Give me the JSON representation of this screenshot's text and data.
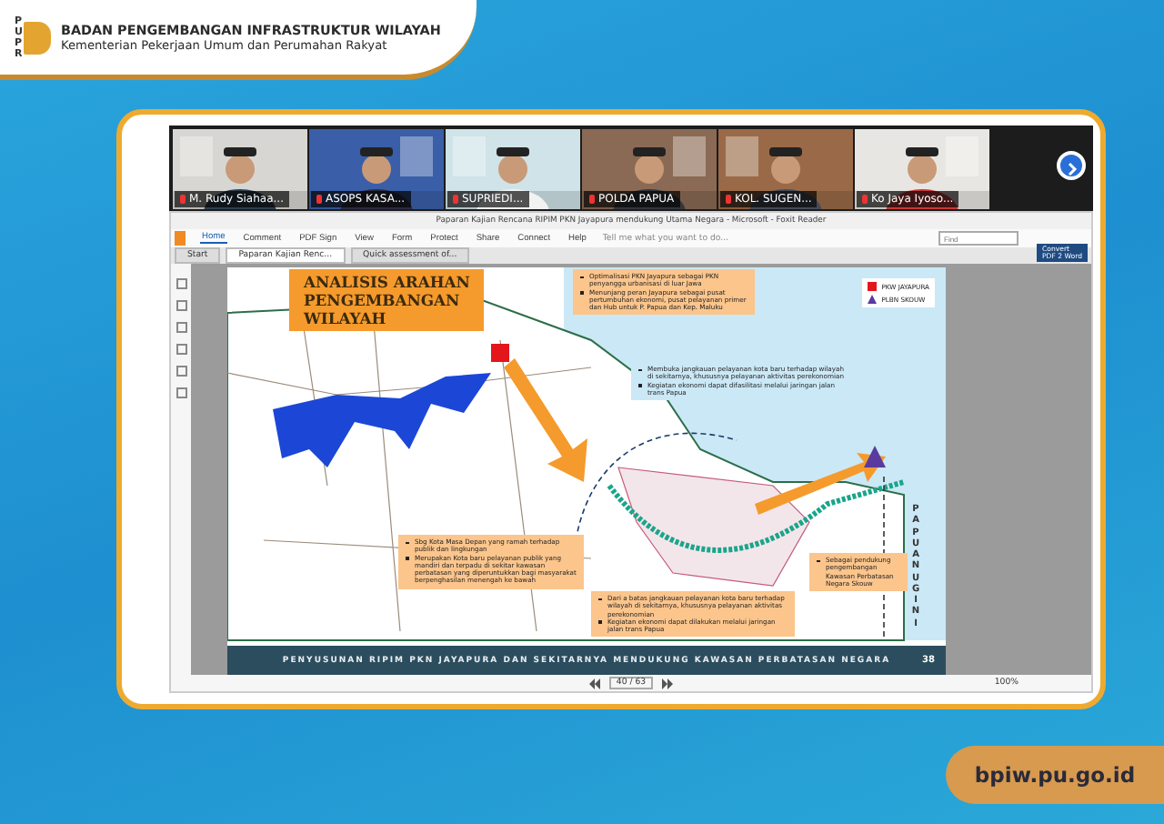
{
  "header": {
    "logo_letters": [
      "P",
      "U",
      "P",
      "R"
    ],
    "title": "BADAN PENGEMBANGAN INFRASTRUKTUR WILAYAH",
    "subtitle": "Kementerian Pekerjaan Umum dan Perumahan Rakyat"
  },
  "video_tiles": [
    {
      "name": "M. Rudy Siahaa...",
      "kind": "picture"
    },
    {
      "name": "ASOPS KASA...",
      "kind": "picture"
    },
    {
      "name": "SUPRIEDI...",
      "kind": "picture"
    },
    {
      "name": "POLDA PAPUA",
      "kind": "picture"
    },
    {
      "name": "KOL. SUGEN...",
      "kind": "picture"
    },
    {
      "name": "Ko Jaya Iyoso...",
      "kind": "picture"
    }
  ],
  "reader": {
    "title": "Paparan Kajian Rencana RIPIM PKN Jayapura mendukung Utama Negara - Microsoft - Foxit Reader",
    "menu": [
      {
        "label": "Home",
        "selected": true
      },
      {
        "label": "Comment",
        "selected": false
      },
      {
        "label": "PDF Sign",
        "selected": false
      },
      {
        "label": "View",
        "selected": false
      },
      {
        "label": "Form",
        "selected": false
      },
      {
        "label": "Protect",
        "selected": false
      },
      {
        "label": "Share",
        "selected": false
      },
      {
        "label": "Connect",
        "selected": false
      },
      {
        "label": "Help",
        "selected": false
      }
    ],
    "tell_me": "Tell me what you want to do...",
    "search": {
      "placeholder": "Find"
    },
    "tabs": [
      {
        "label": "Start",
        "selected": false
      },
      {
        "label": "Paparan Kajian Renc...",
        "selected": true
      },
      {
        "label": "Quick assessment of...",
        "selected": false
      }
    ],
    "ad": {
      "line_1": "Convert",
      "line_2": "PDF 2 Word"
    },
    "page": "40 / 63",
    "zoom": "100%"
  },
  "slide": {
    "title": [
      "ANALISIS ARAHAN",
      "PENGEMBANGAN",
      "WILAYAH"
    ],
    "legend": [
      {
        "label": "PKW JAYAPURA",
        "kind": "square",
        "color": "#e3161b"
      },
      {
        "label": "PLBN SKOUW",
        "kind": "triangle",
        "color": "#5a3a9e"
      }
    ],
    "callouts": [
      {
        "kind": "box",
        "bullets": [
          "Optimalisasi PKN Jayapura sebagai PKN penyangga urbanisasi di luar Jawa",
          "Menunjang peran Jayapura sebagai pusat pertumbuhan ekonomi, pusat pelayanan primer dan Hub untuk P. Papua dan Kep. Maluku"
        ]
      },
      {
        "kind": "plain",
        "bullets": [
          "Membuka jangkauan pelayanan kota baru terhadap wilayah di sekitarnya, khususnya pelayanan aktivitas perekonomian",
          "Kegiatan ekonomi dapat difasilitasi melalui jaringan jalan trans Papua"
        ]
      },
      {
        "kind": "box",
        "bullets": [
          "Sbg Kota Masa Depan yang ramah terhadap publik dan lingkungan",
          "Merupakan Kota baru pelayanan publik yang mandiri dan terpadu di sekitar kawasan perbatasan yang diperuntukkan bagi masyarakat berpenghasilan menengah ke bawah"
        ]
      },
      {
        "kind": "box",
        "bullets": [
          "Dari a batas jangkauan pelayanan kota baru terhadap wilayah di sekitarnya, khususnya pelayanan aktivitas perekonomian",
          "Kegiatan ekonomi dapat dilakukan melalui jaringan jalan trans Papua"
        ]
      },
      {
        "kind": "box",
        "bullets": [
          "Sebagai pendukung pengembangan Kawasan Perbatasan Negara Skouw"
        ]
      }
    ],
    "side_label": "PAPUA NUGINI",
    "footer": "PENYUSUNAN RIPIM PKN JAYAPURA DAN SEKITARNYA MENDUKUNG KAWASAN PERBATASAN NEGARA",
    "page_number": "38"
  },
  "website": "bpiw.pu.go.id"
}
